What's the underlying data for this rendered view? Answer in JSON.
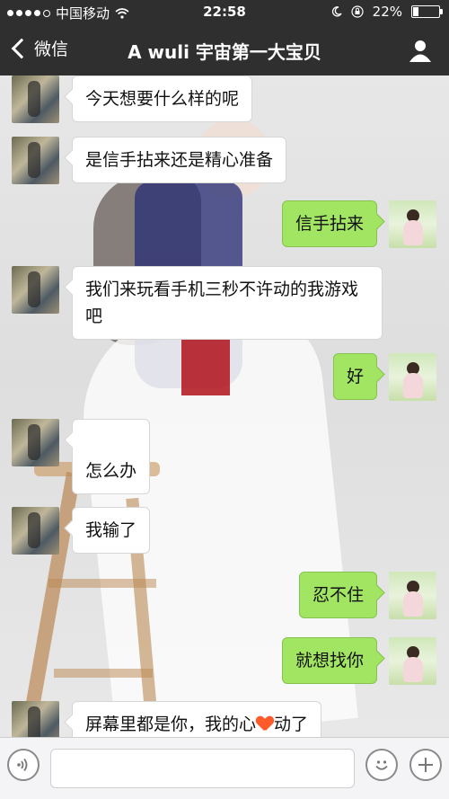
{
  "status_bar": {
    "carrier": "中国移动",
    "time": "22:58",
    "battery_percent": "22%",
    "battery_level": 0.22,
    "icons": [
      "signal-dots-icon",
      "wifi-icon",
      "moon-icon",
      "orientation-lock-icon",
      "battery-icon"
    ]
  },
  "nav": {
    "back_label": "微信",
    "title": "A wuli 宇宙第一大宝贝",
    "profile_icon": "person-icon"
  },
  "messages": [
    {
      "side": "left",
      "text": "今天想要什么样的呢"
    },
    {
      "side": "left",
      "text": "是信手拈来还是精心准备"
    },
    {
      "side": "right",
      "text": "信手拈来"
    },
    {
      "side": "left",
      "text": "我们来玩看手机三秒不许动的我游戏吧"
    },
    {
      "side": "right",
      "text": "好"
    },
    {
      "side": "left",
      "text": "怎么办"
    },
    {
      "side": "left",
      "text": "我输了"
    },
    {
      "side": "right",
      "text": "忍不住"
    },
    {
      "side": "right",
      "text": "就想找你"
    },
    {
      "side": "left",
      "text_before": "屏幕里都是你，我的心",
      "text_after": "动了",
      "inline_icon": "heart-icon"
    }
  ],
  "input_bar": {
    "icons": [
      "voice-icon",
      "emoji-icon",
      "plus-icon"
    ]
  },
  "colors": {
    "bar_bg": "#2f2f2f",
    "bubble_green": "#a2e563",
    "bubble_white": "#ffffff",
    "heart": "#ff5a2a"
  }
}
